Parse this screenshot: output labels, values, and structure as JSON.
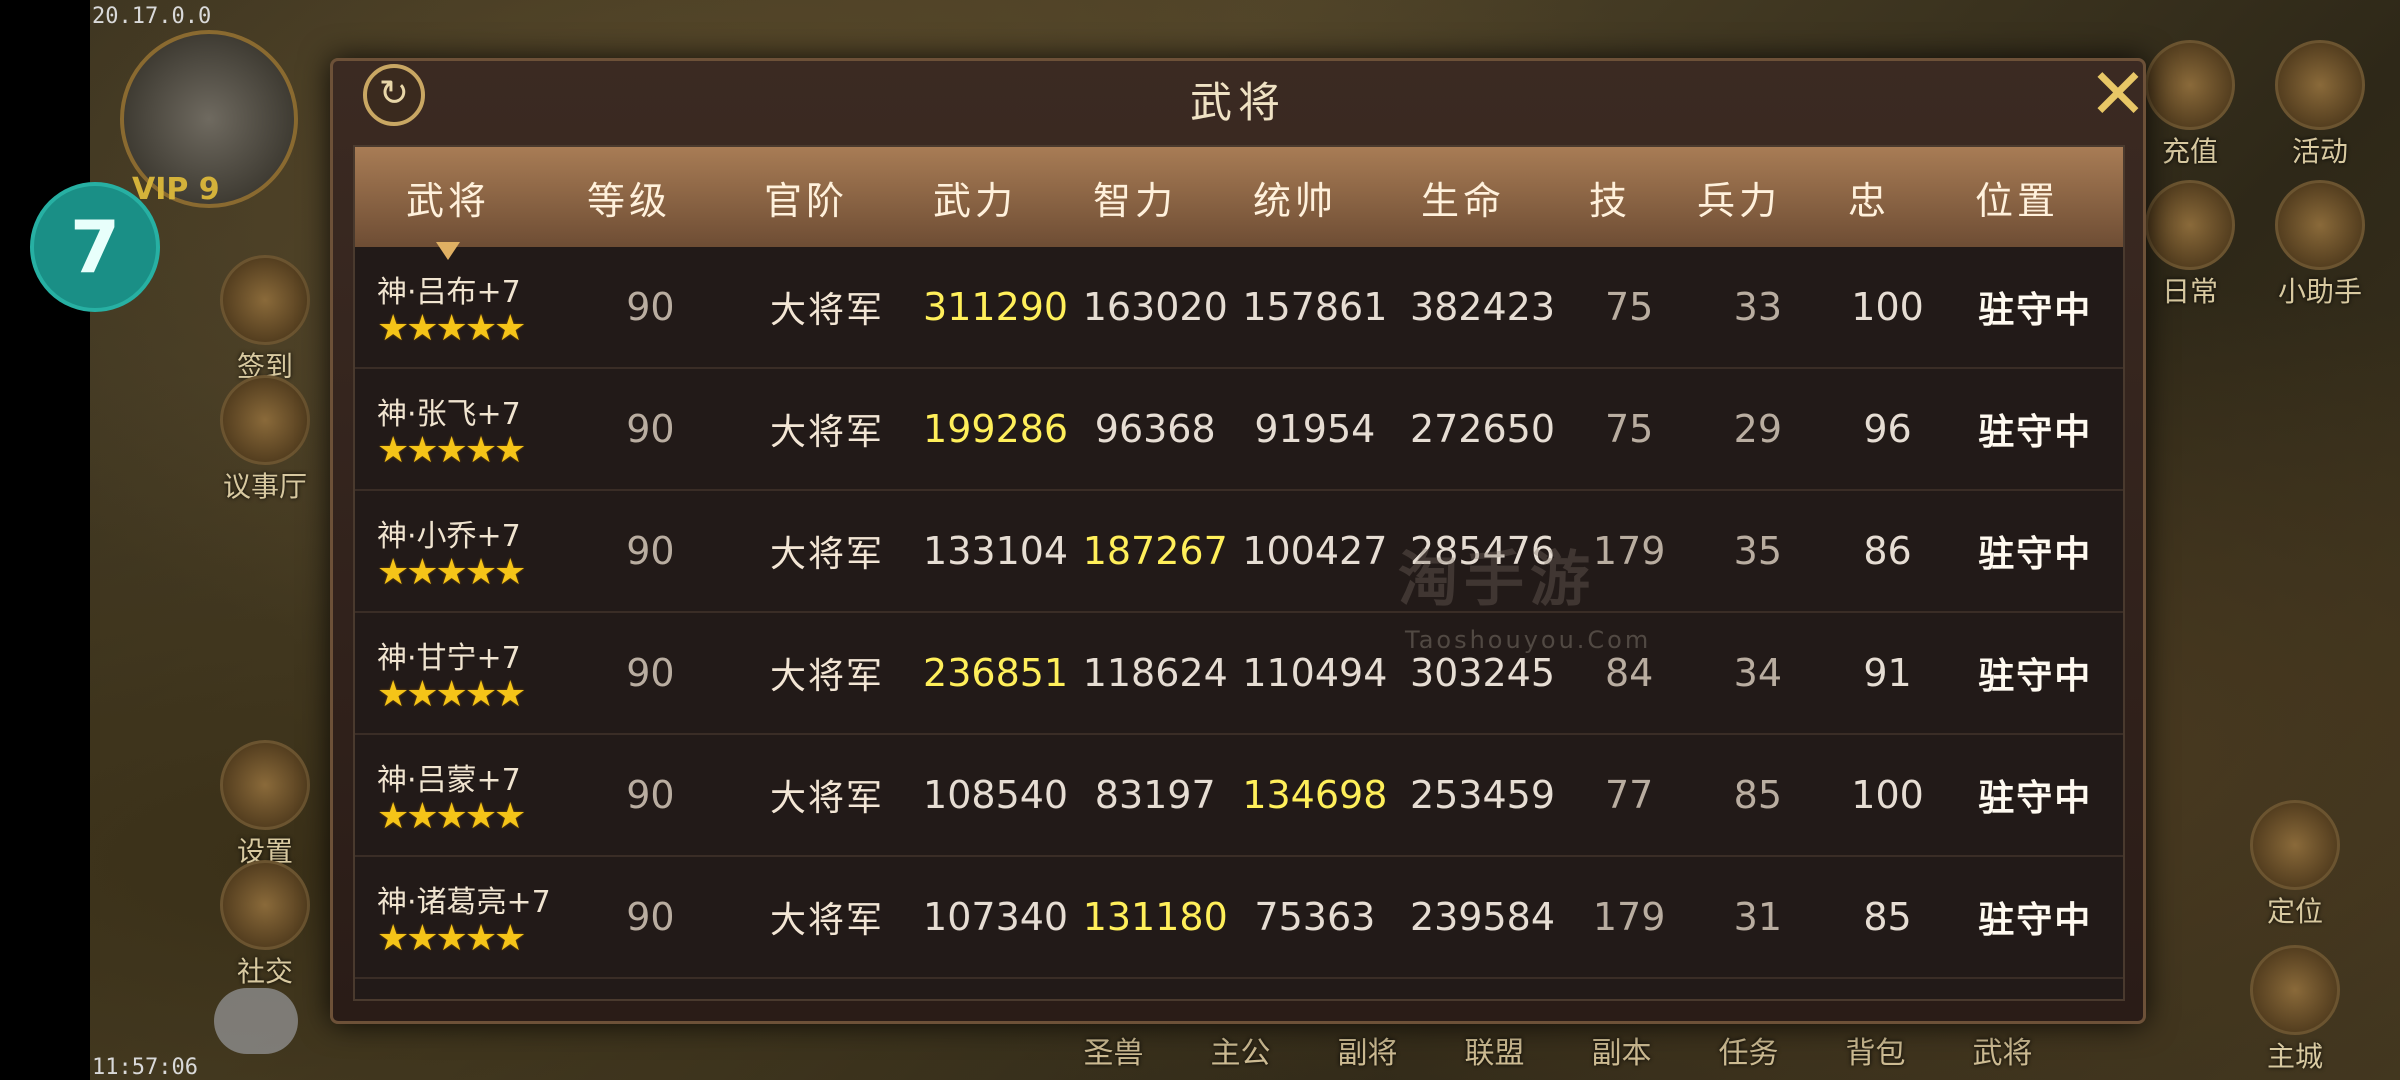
{
  "status": {
    "version": "20.17.0.0",
    "time": "11:57:06"
  },
  "badge": "7",
  "player": {
    "vip": "VIP 9"
  },
  "left_buttons": [
    "签到",
    "议事厅",
    "设置",
    "社交"
  ],
  "right_buttons": [
    "充值",
    "活动",
    "日常",
    "小助手",
    "定位",
    "主城"
  ],
  "bottom_nav": [
    "圣兽",
    "主公",
    "副将",
    "联盟",
    "副本",
    "任务",
    "背包",
    "武将"
  ],
  "panel": {
    "title": "武将",
    "headers": [
      "武将",
      "等级",
      "官阶",
      "武力",
      "智力",
      "统帅",
      "生命",
      "技",
      "兵力",
      "忠",
      "位置"
    ],
    "rows": [
      {
        "name": "神·吕布+7",
        "stars": "★★★★★",
        "level": "90",
        "rank": "大将军",
        "force": "311290",
        "intel": "163020",
        "command": "157861",
        "life": "382423",
        "skill": "75",
        "troops": "33",
        "loyalty": "100",
        "position": "驻守中",
        "highlight": "force"
      },
      {
        "name": "神·张飞+7",
        "stars": "★★★★★",
        "level": "90",
        "rank": "大将军",
        "force": "199286",
        "intel": "96368",
        "command": "91954",
        "life": "272650",
        "skill": "75",
        "troops": "29",
        "loyalty": "96",
        "position": "驻守中",
        "highlight": "force"
      },
      {
        "name": "神·小乔+7",
        "stars": "★★★★★",
        "level": "90",
        "rank": "大将军",
        "force": "133104",
        "intel": "187267",
        "command": "100427",
        "life": "285476",
        "skill": "179",
        "troops": "35",
        "loyalty": "86",
        "position": "驻守中",
        "highlight": "intel"
      },
      {
        "name": "神·甘宁+7",
        "stars": "★★★★★",
        "level": "90",
        "rank": "大将军",
        "force": "236851",
        "intel": "118624",
        "command": "110494",
        "life": "303245",
        "skill": "84",
        "troops": "34",
        "loyalty": "91",
        "position": "驻守中",
        "highlight": "force"
      },
      {
        "name": "神·吕蒙+7",
        "stars": "★★★★★",
        "level": "90",
        "rank": "大将军",
        "force": "108540",
        "intel": "83197",
        "command": "134698",
        "life": "253459",
        "skill": "77",
        "troops": "85",
        "loyalty": "100",
        "position": "驻守中",
        "highlight": "command"
      },
      {
        "name": "神·诸葛亮+7",
        "stars": "★★★★★",
        "level": "90",
        "rank": "大将军",
        "force": "107340",
        "intel": "131180",
        "command": "75363",
        "life": "239584",
        "skill": "179",
        "troops": "31",
        "loyalty": "85",
        "position": "驻守中",
        "highlight": "intel"
      }
    ]
  },
  "watermark": {
    "main": "淘手游",
    "sub": "Taoshouyou.Com"
  }
}
